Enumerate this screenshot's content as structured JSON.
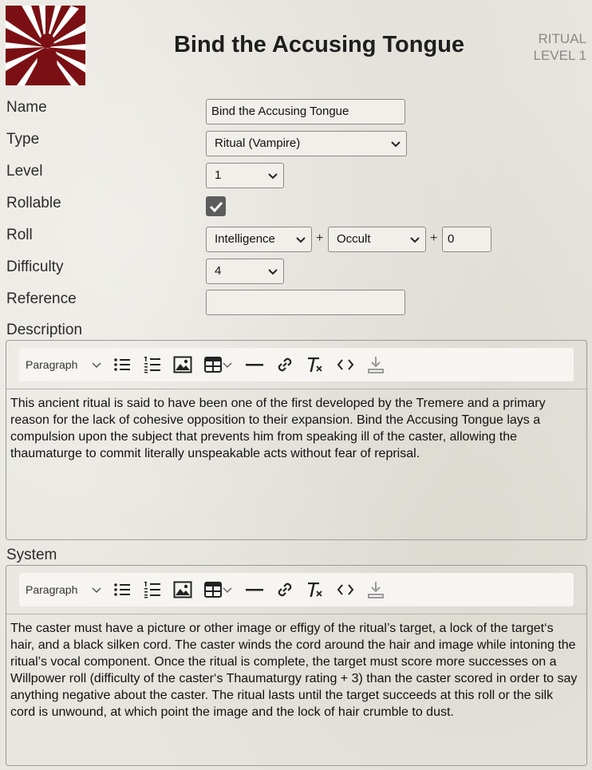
{
  "header": {
    "title": "Bind the Accusing Tongue",
    "item_type": "RITUAL",
    "level_badge": "LEVEL 1"
  },
  "colors": {
    "logo_bg": "#7a1014",
    "checkbox": "#5c5c5c"
  },
  "form": {
    "name_label": "Name",
    "name_value": "Bind the Accusing Tongue",
    "type_label": "Type",
    "type_value": "Ritual (Vampire)",
    "level_label": "Level",
    "level_value": "1",
    "rollable_label": "Rollable",
    "rollable_checked": true,
    "roll_label": "Roll",
    "roll_attribute": "Intelligence",
    "roll_plus_1": "+",
    "roll_skill": "Occult",
    "roll_plus_2": "+",
    "roll_modifier": "0",
    "difficulty_label": "Difficulty",
    "difficulty_value": "4",
    "reference_label": "Reference",
    "reference_value": ""
  },
  "description": {
    "label": "Description",
    "toolbar_format": "Paragraph",
    "text": "This ancient ritual is said to have been one of the first developed by the Tremere and a primary reason for the lack of cohesive opposition to their expansion. Bind the Accusing Tongue lays a compulsion upon the subject that prevents him from speaking ill of the caster, allowing the thaumaturge to commit literally unspeakable acts without fear of reprisal."
  },
  "system": {
    "label": "System",
    "toolbar_format": "Paragraph",
    "text": "The caster must have a picture or other image or effigy of the ritual’s target, a lock of the target‘s hair, and a black silken cord. The caster winds the cord around the hair and image while intoning the ritual’s vocal component. Once the ritual is complete, the target must score more successes on a Willpower roll (difficulty of the caster‘s Thaumaturgy rating + 3) than the caster scored in order to say anything negative about the caster. The ritual lasts until the target succeeds at this roll or the silk cord is unwound, at which point the image and the lock of hair crumble to dust."
  }
}
